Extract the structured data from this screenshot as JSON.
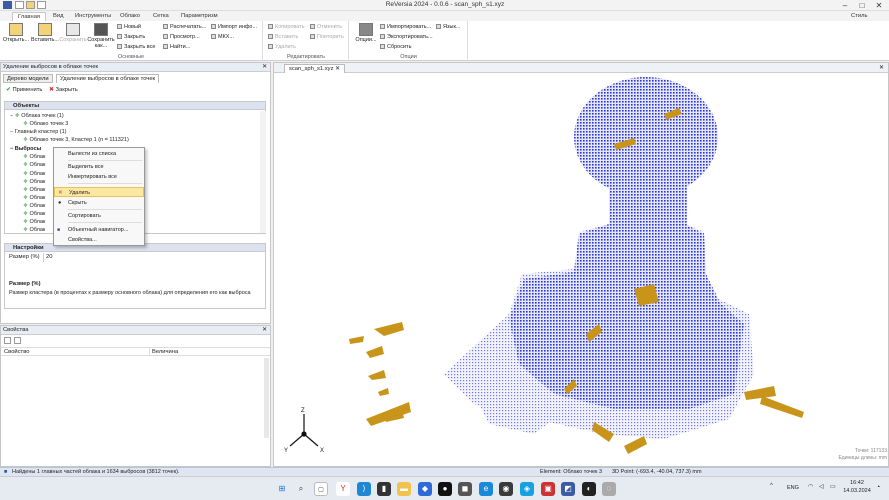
{
  "window": {
    "title": "ReVersia 2024 - 0.0.6 - scan_sph_s1.xyz",
    "style_label": "Стиль",
    "minimize": "–",
    "maximize": "□",
    "close": "✕"
  },
  "tabs": [
    "Главная",
    "Вид",
    "Инструменты",
    "Облако",
    "Сетка",
    "Параметризм"
  ],
  "ribbon": {
    "groups": [
      "Основные",
      "Редактировать",
      "Опции"
    ],
    "open": "Открыть...",
    "paste": "Вставить...",
    "save": "Сохранить",
    "save_as": "Сохранить как...",
    "new": "Новый",
    "close": "Закрыть",
    "close_all": "Закрыть все",
    "print": "Распечатать...",
    "preview": "Просмотр...",
    "find": "Найти...",
    "import_info": "Импорт инфо...",
    "mkh": "МКХ...",
    "copy": "Копировать",
    "insert": "Вставить",
    "delete": "Удалить",
    "undo": "Отменить",
    "redo": "Повторить",
    "options": "Опции...",
    "import": "Импортировать...",
    "export": "Экспортировать...",
    "reset": "Сбросить",
    "language": "Язык..."
  },
  "left_panel": {
    "header": "Удаление выбросов в облаке точек",
    "tabs": [
      "Дерево модели",
      "Удаление выбросов в облаке точек"
    ],
    "apply": "Применить",
    "close": "Закрыть",
    "objects_header": "Объекты",
    "tree": [
      "Облака точек (1)",
      "Облако точек 3",
      "Главный кластер (1)",
      "Облако точек 3, Кластер 1 (n = 111321)",
      "Выбросы",
      "Облак",
      "Облак",
      "Облак",
      "Облак",
      "Облак",
      "Облак",
      "Облак",
      "Облак",
      "Облак",
      "Облак"
    ],
    "settings_header": "Настройки",
    "size_label": "Размер (%)",
    "size_value": "20",
    "desc_title": "Размер (%)",
    "desc_text": "Размер кластера (в процентах к размеру основного облака) для определения его как выброса"
  },
  "context_menu": [
    "Вылести из списка",
    "Выделить все",
    "Инвертировать все",
    "Удалить",
    "Скрыть",
    "Сортировать",
    "Объектный навигатор...",
    "Свойства..."
  ],
  "properties": {
    "header": "Свойства",
    "col_property": "Свойство",
    "col_value": "Величина"
  },
  "viewport": {
    "tab": "scan_sph_s1.xyz",
    "points_label": "Точки: 117133",
    "units_label": "Единицы длины: mm",
    "axis_z": "Z",
    "axis_y": "Y",
    "axis_x": "X"
  },
  "status": {
    "message": "Найдены 1 главных частей облака и 1634 выбросов (3812 точек).",
    "element": "Element: Облако точек 3",
    "point": "3D Point: (-693.4, -40.04, 737.3) mm"
  },
  "taskbar": {
    "lang": "ENG",
    "time": "16:42",
    "date": "14.03.2024"
  },
  "colors": {
    "accent": "#2b579a",
    "points_blue": "#2b35d6",
    "outlier_gold": "#c8941a"
  }
}
